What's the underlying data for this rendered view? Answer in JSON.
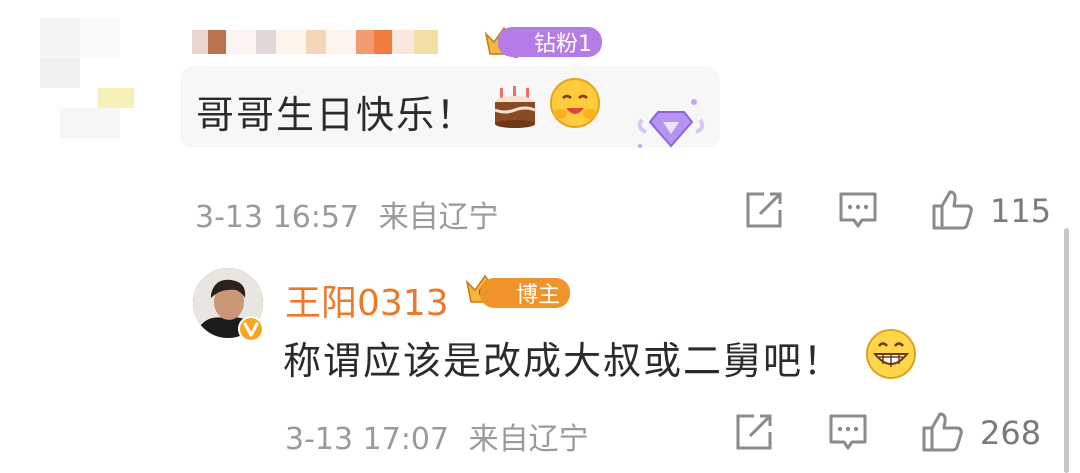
{
  "comment": {
    "text": "哥哥生日快乐！",
    "badge_label": "钻粉1",
    "crown_level": "5",
    "emojis": [
      "cake-emoji",
      "hug-emoji"
    ],
    "timestamp": "3-13 16:57",
    "location": "来自辽宁",
    "like_count": "115"
  },
  "reply": {
    "author": "王阳0313",
    "badge_label": "博主",
    "crown_level": "8",
    "text": "称谓应该是改成大叔或二舅吧！",
    "emoji": "grin-emoji",
    "timestamp": "3-13 17:07",
    "location": "来自辽宁",
    "like_count": "268"
  },
  "colors": {
    "accent_orange": "#ea7a2a",
    "fan_badge_purple": "#b57ce8",
    "blogger_badge_orange": "#f0932b",
    "meta_gray": "#9a9a9a"
  },
  "icons": [
    "share-icon",
    "comment-icon",
    "like-icon",
    "verified-icon",
    "diamond-icon",
    "crown-icon"
  ]
}
